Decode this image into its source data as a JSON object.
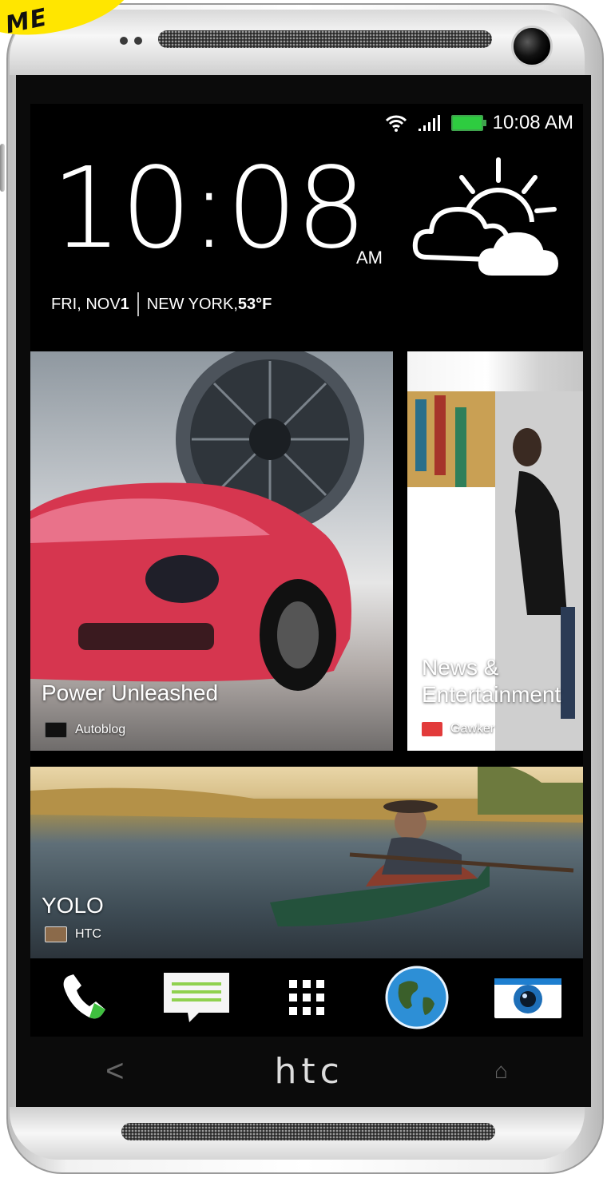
{
  "badge": {
    "text": "ME"
  },
  "status_bar": {
    "time": "10:08 AM"
  },
  "clock": {
    "time": "10:08",
    "ampm": "AM",
    "day_date_prefix": "FRI, NOV ",
    "day_date_number": "1",
    "location_prefix": "NEW YORK, ",
    "temperature": "53°F"
  },
  "tiles": [
    {
      "title": "Power Unleashed",
      "source": "Autoblog"
    },
    {
      "title_line1": "News &",
      "title_line2": "Entertainment",
      "source": "Gawker"
    },
    {
      "title": "YOLO",
      "source": "HTC"
    }
  ],
  "dock": [
    "phone-icon",
    "messages-icon",
    "app-drawer-icon",
    "browser-globe-icon",
    "camera-icon"
  ],
  "nav": {
    "back": "<",
    "logo": "htc",
    "home": "⌂"
  },
  "colors": {
    "battery": "#2ecc40",
    "badge": "#ffe600",
    "dialer_green": "#3fbf3f",
    "messages_green": "#8fd14f"
  }
}
